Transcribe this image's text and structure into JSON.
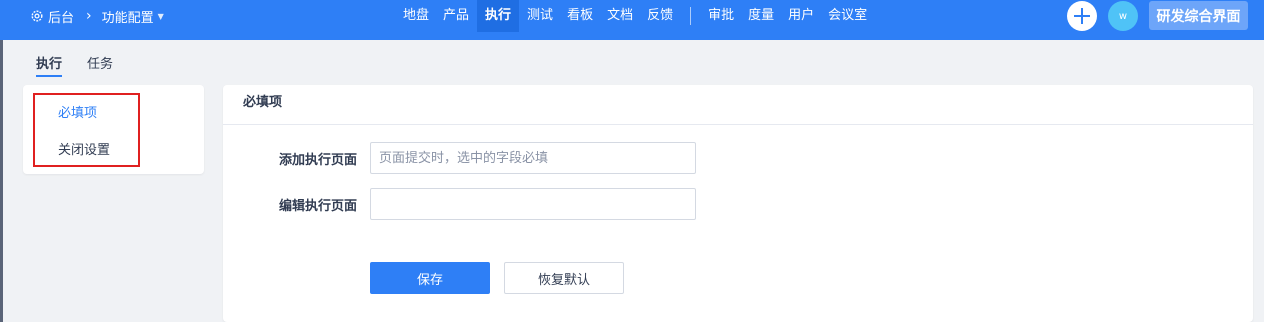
{
  "breadcrumb": {
    "root": "后台",
    "current": "功能配置"
  },
  "nav": {
    "items": [
      "地盘",
      "产品",
      "执行",
      "测试",
      "看板",
      "文档",
      "反馈"
    ],
    "secondary": [
      "审批",
      "度量",
      "用户",
      "会议室"
    ],
    "active": "执行"
  },
  "user": {
    "avatar": "w",
    "switch_label": "研发综合界面"
  },
  "tabs": [
    "执行",
    "任务"
  ],
  "sidebar": {
    "items": [
      "必填项",
      "关闭设置"
    ],
    "active": "必填项"
  },
  "main": {
    "title": "必填项",
    "fields": [
      {
        "label": "添加执行页面",
        "value": "",
        "placeholder": "页面提交时，选中的字段必填"
      },
      {
        "label": "编辑执行页面",
        "value": "",
        "placeholder": ""
      }
    ],
    "save_label": "保存",
    "reset_label": "恢复默认"
  },
  "colors": {
    "primary": "#2e7ff6",
    "highlight": "#e02020",
    "background": "#f0f2f5"
  }
}
